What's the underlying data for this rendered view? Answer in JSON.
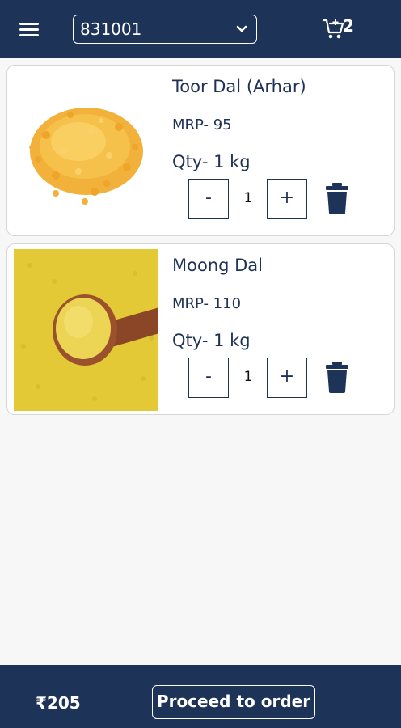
{
  "header": {
    "pincode_value": "831001",
    "cart_count": "2"
  },
  "cart": {
    "items": [
      {
        "name": "Toor Dal (Arhar)",
        "mrp": "MRP- 95",
        "qty_label": "Qty- 1 kg",
        "minus_label": "-",
        "quantity": "1",
        "plus_label": "+"
      },
      {
        "name": "Moong Dal",
        "mrp": "MRP- 110",
        "qty_label": "Qty- 1 kg",
        "minus_label": "-",
        "quantity": "1",
        "plus_label": "+"
      }
    ]
  },
  "footer": {
    "total": "₹205",
    "proceed_label": "Proceed to order"
  },
  "icons": {
    "menu": "hamburger-menu-icon",
    "dropdown": "chevron-down-icon",
    "cart": "cart-add-icon",
    "delete": "trash-icon"
  },
  "colors": {
    "primary": "#1e3358",
    "text": "#1f3155",
    "card_border": "#d6d6d6",
    "background": "#f7f7f7"
  }
}
